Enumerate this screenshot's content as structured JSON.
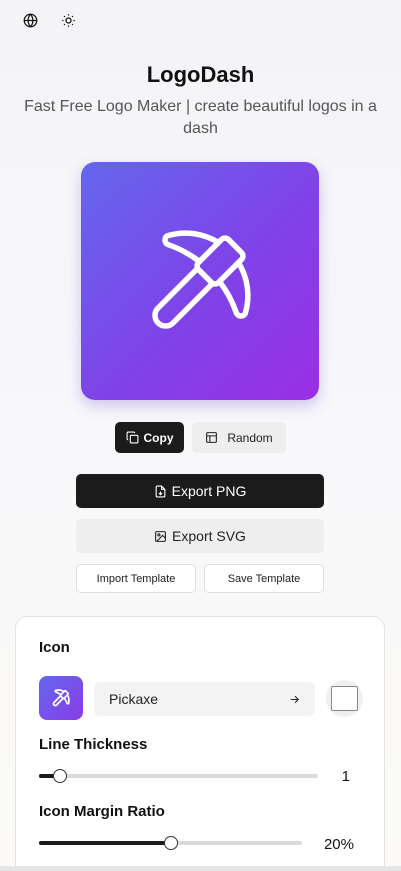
{
  "header": {
    "icons": [
      "globe-icon",
      "sun-icon"
    ]
  },
  "app": {
    "title": "LogoDash",
    "subtitle": "Fast Free Logo Maker | create beautiful logos in a dash"
  },
  "preview": {
    "icon": "pickaxe-icon",
    "gradient_start": "#6467ee",
    "gradient_end": "#9a2fe6",
    "icon_color": "#ffffff"
  },
  "actions": {
    "copy_label": "Copy",
    "random_label": "Random",
    "export_png_label": "Export PNG",
    "export_svg_label": "Export SVG",
    "import_template_label": "Import Template",
    "save_template_label": "Save Template"
  },
  "panel": {
    "icon_label": "Icon",
    "icon_name": "Pickaxe",
    "icon_color": "#ffffff",
    "line_thickness_label": "Line Thickness",
    "line_thickness_value": "1",
    "line_thickness_fraction": 0.075,
    "icon_margin_label": "Icon Margin Ratio",
    "icon_margin_value": "20%",
    "icon_margin_fraction": 0.5
  }
}
